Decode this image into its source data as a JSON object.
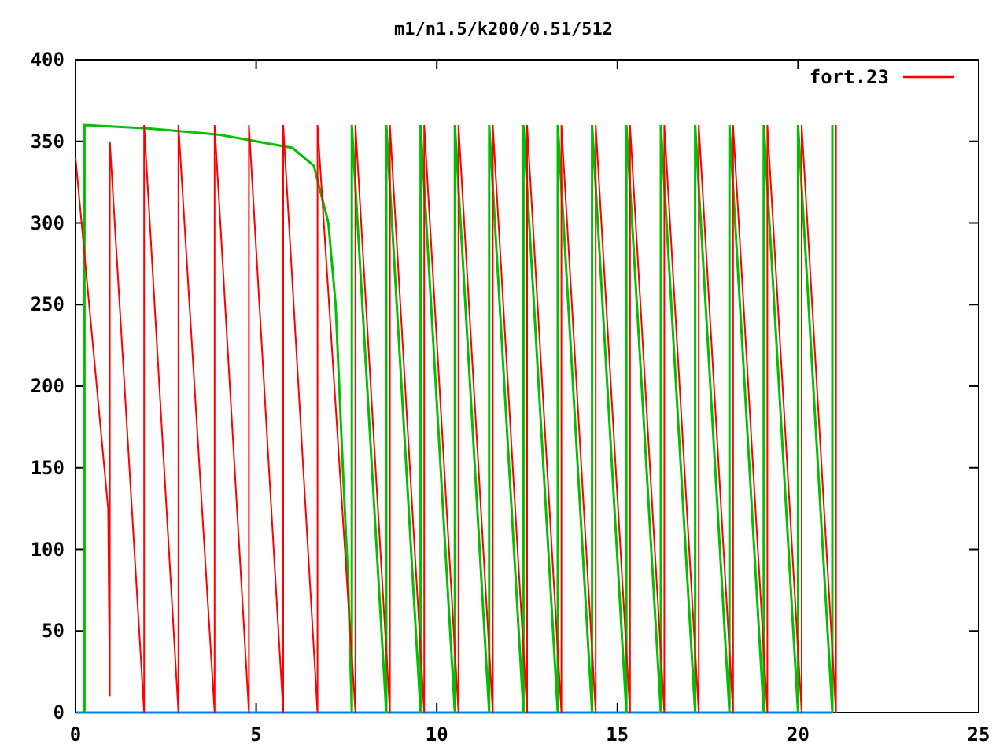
{
  "chart_data": {
    "type": "line",
    "title": "m1/n1.5/k200/0.51/512",
    "xlim": [
      0,
      25
    ],
    "ylim": [
      0,
      400
    ],
    "xticks": [
      0,
      5,
      10,
      15,
      20,
      25
    ],
    "yticks": [
      0,
      50,
      100,
      150,
      200,
      250,
      300,
      350,
      400
    ],
    "series": [
      {
        "name": "fort.23",
        "color": "#ff0000",
        "x": [
          0,
          0.9,
          0.95,
          0.95,
          1.9,
          1.9,
          2.85,
          2.85,
          3.85,
          3.85,
          4.8,
          4.8,
          5.75,
          5.75,
          6.7,
          6.7,
          7.75,
          7.75,
          8.7,
          8.7,
          9.65,
          9.65,
          10.6,
          10.6,
          11.55,
          11.55,
          12.5,
          12.5,
          13.45,
          13.45,
          14.4,
          14.4,
          15.35,
          15.35,
          16.3,
          16.3,
          17.25,
          17.25,
          18.2,
          18.2,
          19.15,
          19.15,
          20.1,
          20.1,
          21.05,
          21.05
        ],
        "values": [
          340,
          125,
          10,
          350,
          0,
          360,
          0,
          360,
          0,
          360,
          0,
          360,
          0,
          360,
          0,
          360,
          0,
          360,
          0,
          360,
          0,
          360,
          0,
          360,
          0,
          360,
          0,
          360,
          0,
          360,
          0,
          360,
          0,
          360,
          0,
          360,
          0,
          360,
          0,
          360,
          0,
          360,
          0,
          360,
          0,
          360
        ]
      },
      {
        "color": "#00c000",
        "x": [
          0.25,
          0.25,
          2,
          4,
          6,
          6.6,
          7,
          7.2,
          7.4,
          7.55,
          7.65,
          7.65,
          8.6,
          8.6,
          9.55,
          9.55,
          10.5,
          10.5,
          11.45,
          11.45,
          12.4,
          12.4,
          13.35,
          13.35,
          14.3,
          14.3,
          15.25,
          15.25,
          16.2,
          16.2,
          17.15,
          17.15,
          18.1,
          18.1,
          19.05,
          19.05,
          20,
          20,
          20.95,
          20.95,
          20.95
        ],
        "values": [
          0,
          360,
          358,
          354,
          346,
          335,
          300,
          250,
          150,
          80,
          0,
          360,
          0,
          360,
          0,
          360,
          0,
          360,
          0,
          360,
          0,
          360,
          0,
          360,
          0,
          360,
          0,
          360,
          0,
          360,
          0,
          360,
          0,
          360,
          0,
          360,
          0,
          360,
          0,
          360,
          0
        ]
      },
      {
        "color": "#0080ff",
        "x": [
          0,
          20.95
        ],
        "values": [
          0,
          0
        ]
      }
    ]
  }
}
